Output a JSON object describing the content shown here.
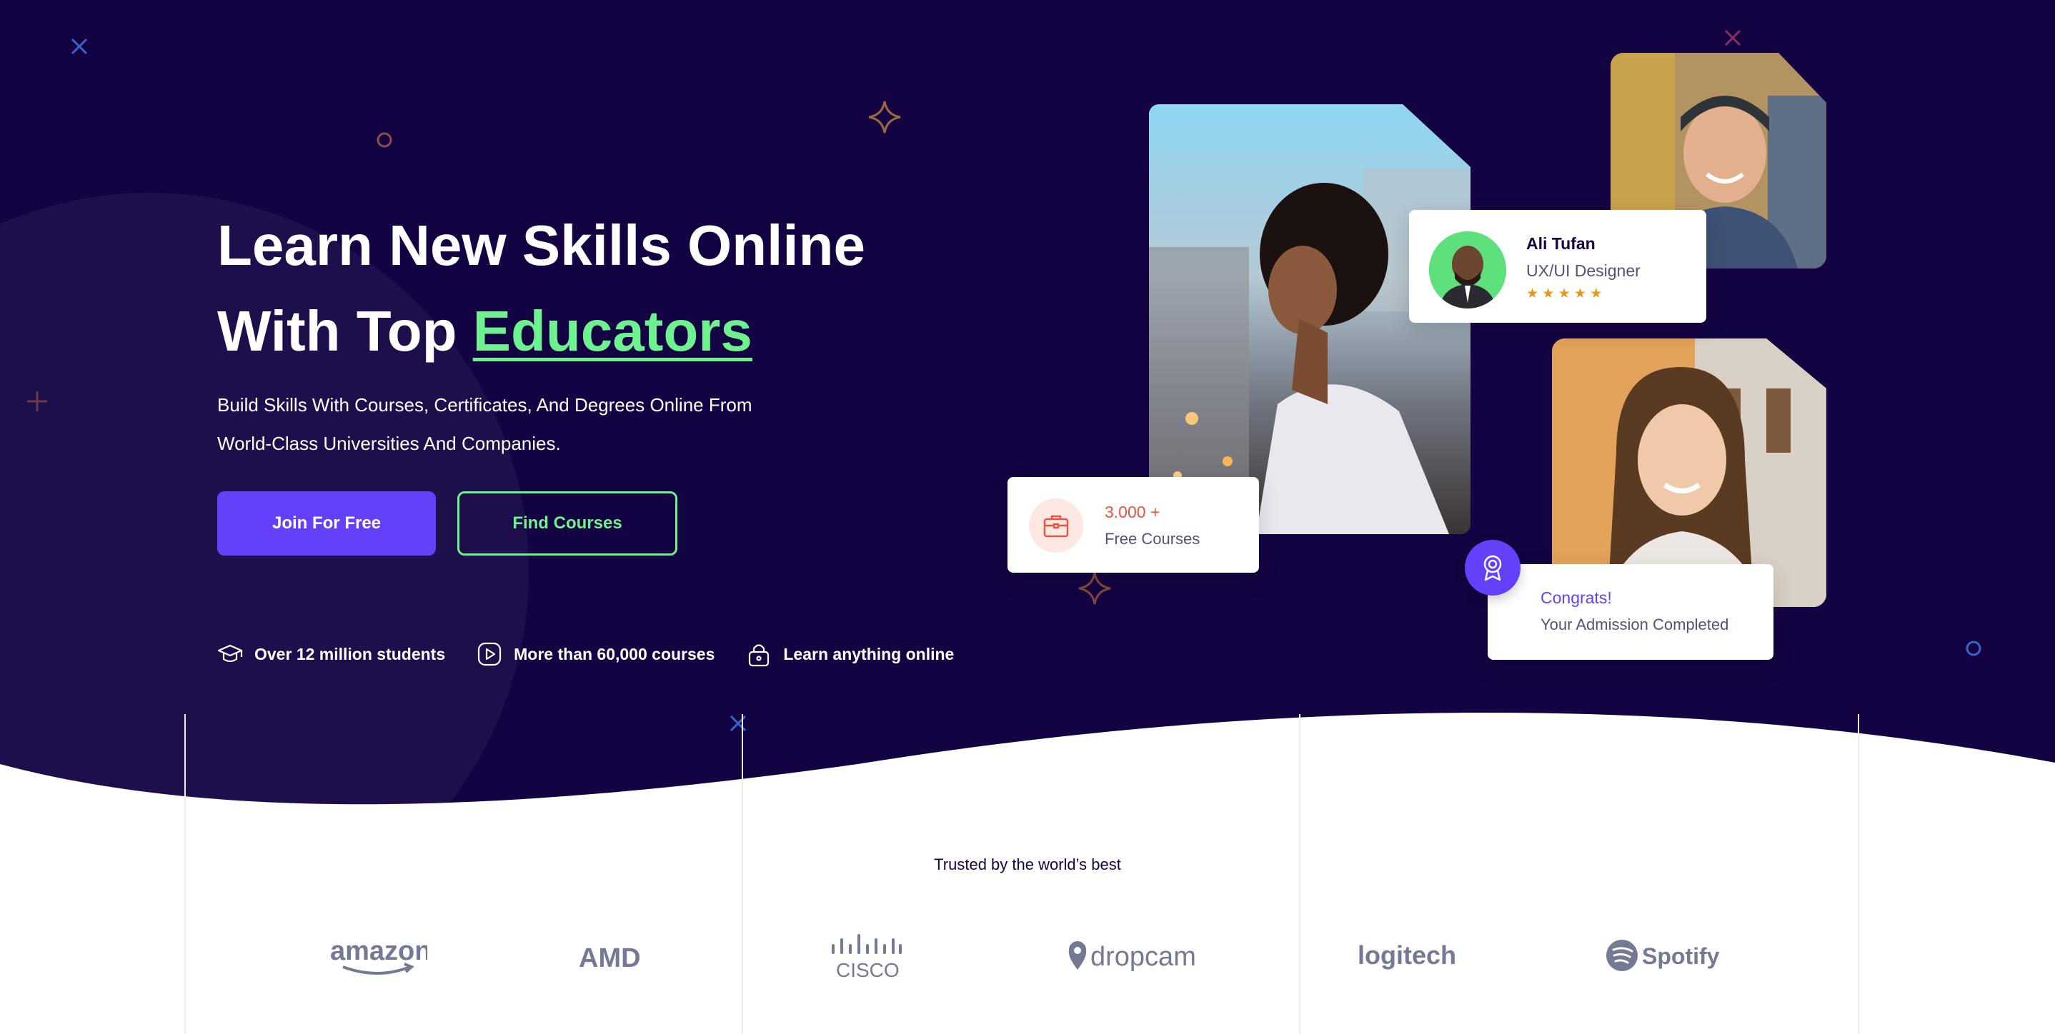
{
  "hero": {
    "title_line1": "Learn New Skills Online",
    "title_line2_prefix": "With Top",
    "title_accent": "Educators",
    "subtitle_line1": "Build Skills With Courses, Certificates, And Degrees Online From",
    "subtitle_line2": "World-Class Universities And Companies.",
    "join_button": "Join For Free",
    "find_button": "Find Courses",
    "features": [
      {
        "icon": "graduation-cap-icon",
        "label": "Over 12 million students"
      },
      {
        "icon": "play-icon",
        "label": "More than 60,000 courses"
      },
      {
        "icon": "lock-icon",
        "label": "Learn anything online"
      }
    ]
  },
  "cards": {
    "tutor": {
      "name": "Ali Tufan",
      "role": "UX/UI Designer",
      "rating_stars": 5,
      "stars": "★ ★ ★ ★ ★"
    },
    "free_courses": {
      "count": "3.000 +",
      "label": "Free Courses",
      "icon": "briefcase-icon"
    },
    "congrats": {
      "title": "Congrats!",
      "subtitle": "Your Admission Completed",
      "icon": "award-icon"
    }
  },
  "trusted": {
    "heading": "Trusted by the world’s best",
    "logos": [
      "amazon",
      "AMD",
      "CISCO",
      "dropcam",
      "logitech",
      "Spotify"
    ]
  },
  "colors": {
    "hero_bg": "#140342",
    "accent_green": "#6ef18f",
    "primary_purple": "#6440fb",
    "free_courses_red": "#e8543e",
    "star_orange": "#e59819",
    "logo_gray": "#747a93"
  }
}
